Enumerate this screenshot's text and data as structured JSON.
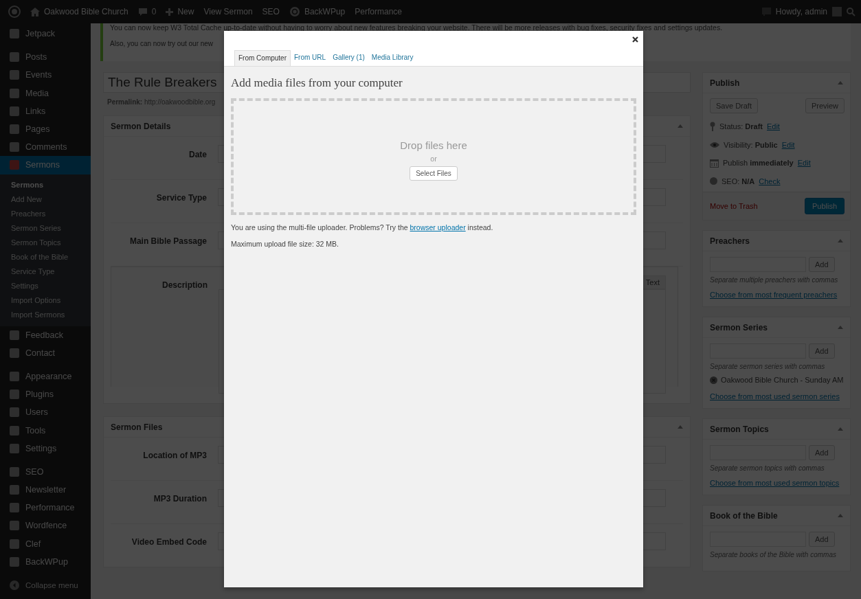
{
  "admin_bar": {
    "site_name": "Oakwood Bible Church",
    "comments_count": "0",
    "new_label": "New",
    "items": [
      "View Sermon",
      "SEO",
      "BackWPup",
      "Performance"
    ],
    "greeting": "Howdy, admin"
  },
  "sidebar": {
    "groups": [
      [
        {
          "label": "Jetpack",
          "selected": false
        }
      ],
      [
        {
          "label": "Posts",
          "selected": false
        },
        {
          "label": "Events",
          "selected": false
        },
        {
          "label": "Media",
          "selected": false
        },
        {
          "label": "Links",
          "selected": false
        },
        {
          "label": "Pages",
          "selected": false
        },
        {
          "label": "Comments",
          "selected": false
        },
        {
          "label": "Sermons",
          "selected": true,
          "children": [
            {
              "label": "Sermons",
              "selected": true
            },
            {
              "label": "Add New",
              "selected": false
            },
            {
              "label": "Preachers",
              "selected": false
            },
            {
              "label": "Sermon Series",
              "selected": false
            },
            {
              "label": "Sermon Topics",
              "selected": false
            },
            {
              "label": "Book of the Bible",
              "selected": false
            },
            {
              "label": "Service Type",
              "selected": false
            },
            {
              "label": "Settings",
              "selected": false
            },
            {
              "label": "Import Options",
              "selected": false
            },
            {
              "label": "Import Sermons",
              "selected": false
            }
          ]
        },
        {
          "label": "Feedback",
          "selected": false
        },
        {
          "label": "Contact",
          "selected": false
        }
      ],
      [
        {
          "label": "Appearance",
          "selected": false
        },
        {
          "label": "Plugins",
          "selected": false
        },
        {
          "label": "Users",
          "selected": false
        },
        {
          "label": "Tools",
          "selected": false
        },
        {
          "label": "Settings",
          "selected": false
        }
      ],
      [
        {
          "label": "SEO",
          "selected": false
        },
        {
          "label": "Newsletter",
          "selected": false
        },
        {
          "label": "Performance",
          "selected": false
        },
        {
          "label": "Wordfence",
          "selected": false
        },
        {
          "label": "Clef",
          "selected": false
        },
        {
          "label": "BackWPup",
          "selected": false
        }
      ]
    ],
    "collapse_label": "Collapse menu"
  },
  "notice": {
    "lines": [
      "You can now keep W3 Total Cache up-to-date without having to worry about new features breaking your website. There will be more releases with bug fixes, security fixes and settings updates.",
      "Also, you can now try out our new"
    ]
  },
  "post": {
    "title": "The Rule Breakers",
    "permalink_label": "Permalink:",
    "permalink": "http://oakwoodbible.org"
  },
  "boxes": [
    {
      "title": "Sermon Details",
      "rows": [
        {
          "label": "Date",
          "kind": "input"
        },
        {
          "label": "Service Type",
          "kind": "input"
        },
        {
          "label": "Main Bible Passage",
          "kind": "input"
        },
        {
          "label": "Description",
          "kind": "editor",
          "editor_tab": "Text"
        }
      ]
    },
    {
      "title": "Sermon Files",
      "rows": [
        {
          "label": "Location of MP3",
          "kind": "input"
        },
        {
          "label": "MP3 Duration",
          "kind": "input"
        },
        {
          "label": "Video Embed Code",
          "kind": "input"
        }
      ]
    }
  ],
  "publish": {
    "title": "Publish",
    "save_draft": "Save Draft",
    "preview": "Preview",
    "rows": [
      {
        "kind": "status",
        "text": "Status: **Draft**",
        "link": "Edit"
      },
      {
        "kind": "visibility",
        "text": "Visibility: **Public**",
        "link": "Edit"
      },
      {
        "kind": "schedule",
        "text": "Publish **immediately**",
        "link": "Edit"
      },
      {
        "kind": "seo",
        "text": "SEO: **N/A**",
        "link": "Check"
      }
    ],
    "trash": "Move to Trash",
    "publish_button": "Publish"
  },
  "taxonomies": [
    {
      "title": "Preachers",
      "add": "Add",
      "hint": "Separate multiple preachers with commas",
      "link": "Choose from most frequent preachers"
    },
    {
      "title": "Sermon Series",
      "add": "Add",
      "hint": "Separate sermon series with commas",
      "tags": [
        "Oakwood Bible Church - Sunday AM"
      ],
      "link": "Choose from most used sermon series"
    },
    {
      "title": "Sermon Topics",
      "add": "Add",
      "hint": "Separate sermon topics with commas",
      "link": "Choose from most used sermon topics"
    },
    {
      "title": "Book of the Bible",
      "add": "Add",
      "hint": "Separate books of the Bible with commas"
    }
  ],
  "modal": {
    "tabs": [
      {
        "label": "From Computer",
        "selected": true
      },
      {
        "label": "From URL",
        "selected": false
      },
      {
        "label": "Gallery (1)",
        "selected": false
      },
      {
        "label": "Media Library",
        "selected": false
      }
    ],
    "heading": "Add media files from your computer",
    "drop_text": "Drop files here",
    "or": "or",
    "select_button": "Select Files",
    "uploader_note": "You are using the multi-file uploader. Problems? Try the",
    "uploader_link": "browser uploader",
    "uploader_after": "instead.",
    "max_size": "Maximum upload file size: 32 MB."
  }
}
